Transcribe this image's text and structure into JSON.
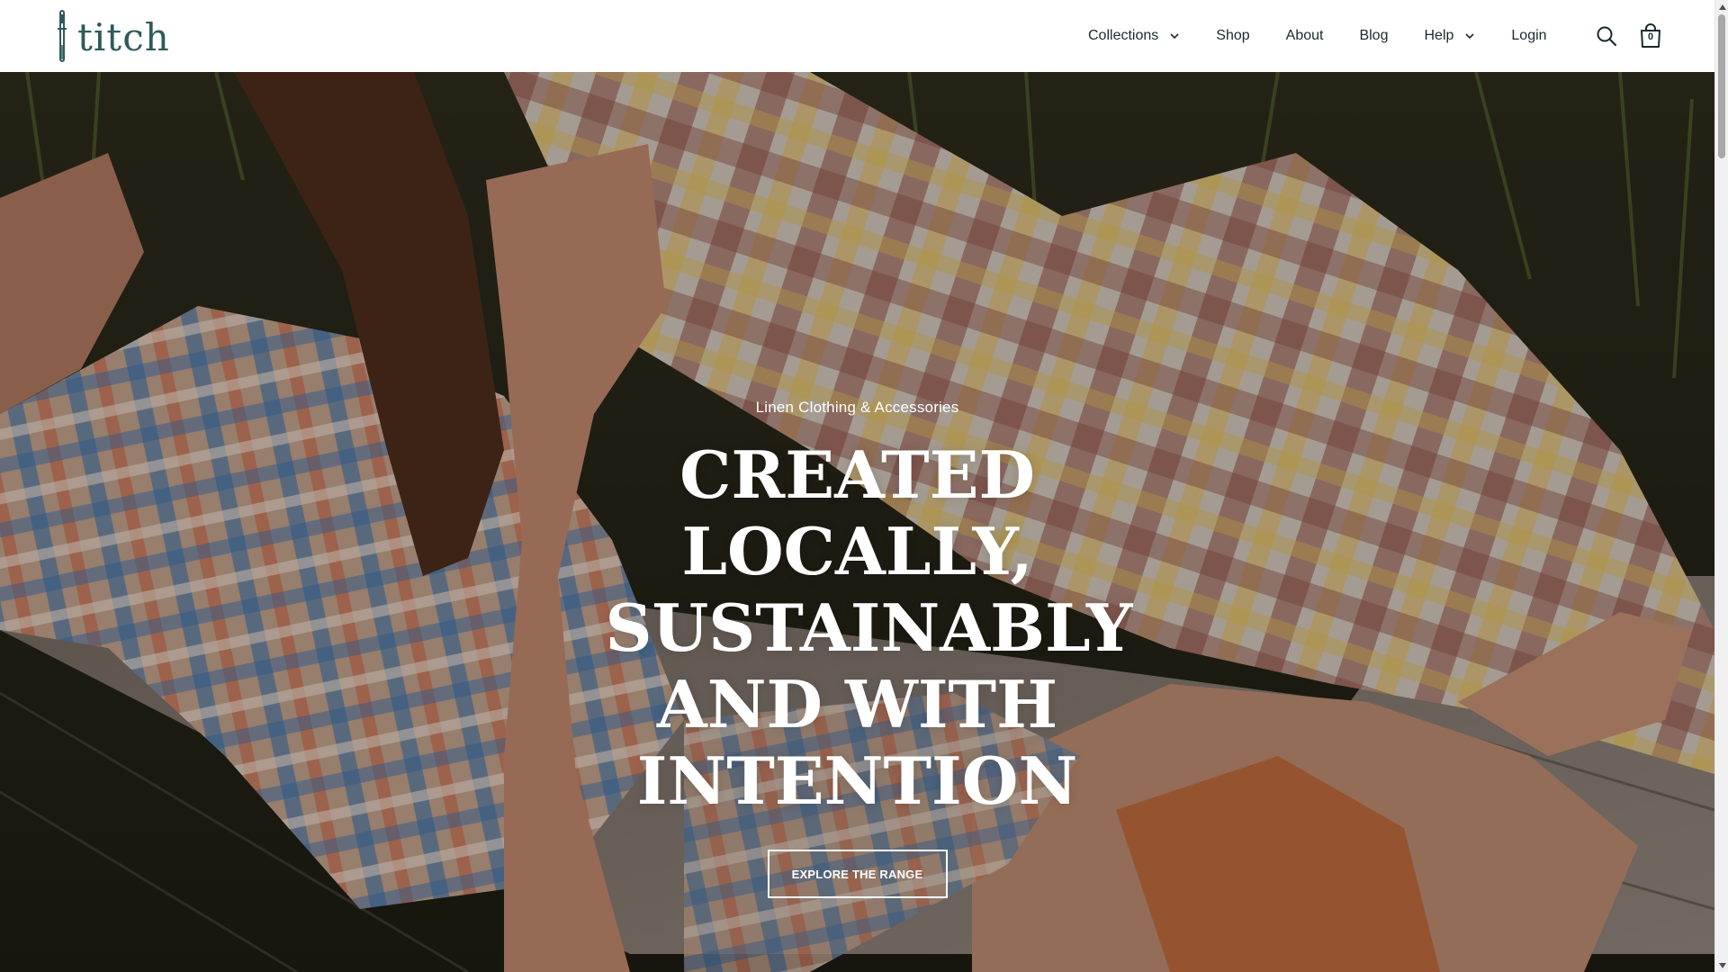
{
  "brand": {
    "logo_text": "titch",
    "logo_color": "#2f5a5c"
  },
  "nav": {
    "items": [
      {
        "label": "Collections",
        "has_dropdown": true
      },
      {
        "label": "Shop",
        "has_dropdown": false
      },
      {
        "label": "About",
        "has_dropdown": false
      },
      {
        "label": "Blog",
        "has_dropdown": false
      },
      {
        "label": "Help",
        "has_dropdown": true
      },
      {
        "label": "Login",
        "has_dropdown": false
      }
    ],
    "text_color": "#1b2a2c"
  },
  "header_icons": {
    "search": "search-icon",
    "cart": "shopping-bag-icon",
    "cart_count": "0"
  },
  "hero": {
    "subtitle": "Linen Clothing & Accessories",
    "title": "CREATED LOCALLY, SUSTAINABLY AND WITH INTENTION",
    "button_label": "EXPLORE THE RANGE",
    "text_color": "#ffffff"
  }
}
